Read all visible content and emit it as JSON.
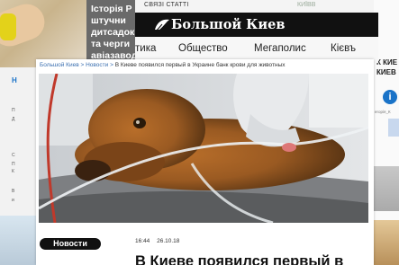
{
  "background": {
    "news_card_text": "Історія Р\nштучни\nдитсадок\nта черги\nавіазавод",
    "top_strip_text": "СВЯЗІ СТАТТІ",
    "top_strip_right": "КИЇВВ",
    "right_column_title": "К КИЕ\nКИЕВ",
    "right_column_small": "егорія_К",
    "side_texts": [
      "Н",
      "П",
      "Д",
      "С",
      "П",
      "К",
      "В",
      "и"
    ]
  },
  "header": {
    "logo_text": "Большой Киев",
    "nav": [
      "тика",
      "Общество",
      "Мегаполис",
      "Кієвъ"
    ]
  },
  "article": {
    "breadcrumbs": [
      "Большой Киев",
      "Новости",
      "В Киеве появился первый в Украине банк крови для животных"
    ],
    "separator": ">",
    "category": "Новости",
    "time": "16:44",
    "date": "26.10.18",
    "headline": "В Киеве появился первый в"
  },
  "colors": {
    "brand_bar": "#111111",
    "link": "#3a6fb0",
    "tag_bg": "#111111"
  }
}
